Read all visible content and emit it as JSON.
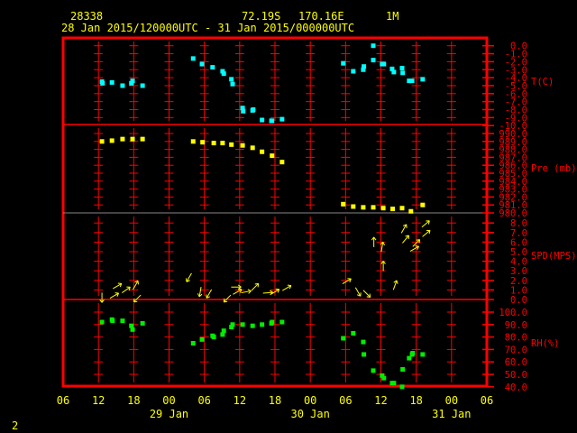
{
  "header": {
    "station": "28338",
    "lat": "72.19S",
    "lon": "170.16E",
    "height": "1M",
    "period": "28 Jan 2015/120000UTC - 31 Jan 2015/000000UTC"
  },
  "page_number": "2",
  "colors": {
    "frame": "#ff0000",
    "temp": "#00ffff",
    "pressure": "#ffff00",
    "wind": "#ffff00",
    "rh": "#00ee00",
    "text": "#ffff00"
  },
  "chart_data": {
    "type": "scatter",
    "x_units": "hours since 28 Jan 2015 06UTC",
    "x_range": [
      0,
      72
    ],
    "x_ticks": [
      "06",
      "12",
      "18",
      "00",
      "06",
      "12",
      "18",
      "00",
      "06",
      "12",
      "18",
      "00",
      "06"
    ],
    "x_dates": [
      {
        "label": "29 Jan",
        "hour": 18
      },
      {
        "label": "30 Jan",
        "hour": 42
      },
      {
        "label": "31 Jan",
        "hour": 66
      }
    ],
    "panels": [
      {
        "name": "temperature",
        "label": "T(C)",
        "ticks": [
          "0.0",
          "-1.0",
          "-2.0",
          "-3.0",
          "-4.0",
          "-5.0",
          "-6.0",
          "-7.0",
          "-8.0",
          "-9.0",
          "-10.0"
        ],
        "range": [
          -10,
          0
        ],
        "points": [
          [
            6.6,
            -4.5
          ],
          [
            6.7,
            -4.7
          ],
          [
            8.3,
            -4.6
          ],
          [
            10.1,
            -5.0
          ],
          [
            11.6,
            -4.7
          ],
          [
            11.8,
            -4.4
          ],
          [
            13.5,
            -5.0
          ],
          [
            22.1,
            -1.6
          ],
          [
            23.6,
            -2.3
          ],
          [
            25.4,
            -2.7
          ],
          [
            27.1,
            -3.2
          ],
          [
            27.3,
            -3.5
          ],
          [
            28.6,
            -4.2
          ],
          [
            28.8,
            -4.8
          ],
          [
            30.5,
            -7.8
          ],
          [
            30.6,
            -8.2
          ],
          [
            32.2,
            -8.1
          ],
          [
            32.3,
            -8.0
          ],
          [
            33.8,
            -9.3
          ],
          [
            35.4,
            -9.4
          ],
          [
            35.5,
            -9.4
          ],
          [
            37.2,
            -9.2
          ],
          [
            47.6,
            -2.2
          ],
          [
            49.3,
            -3.2
          ],
          [
            51.0,
            -3.0
          ],
          [
            51.1,
            -2.6
          ],
          [
            52.7,
            0.0
          ],
          [
            52.7,
            -1.8
          ],
          [
            54.2,
            -2.3
          ],
          [
            54.5,
            -2.3
          ],
          [
            55.9,
            -2.9
          ],
          [
            56.2,
            -3.3
          ],
          [
            57.6,
            -2.8
          ],
          [
            57.7,
            -3.4
          ],
          [
            58.8,
            -4.4
          ],
          [
            59.3,
            -4.4
          ],
          [
            61.1,
            -4.2
          ]
        ]
      },
      {
        "name": "pressure",
        "label": "Pre (mb)",
        "ticks": [
          "990.0",
          "989.0",
          "988.0",
          "987.0",
          "986.0",
          "985.0",
          "984.0",
          "983.0",
          "982.0",
          "981.0",
          "980.0"
        ],
        "range": [
          980,
          990
        ],
        "points": [
          [
            6.6,
            989.0
          ],
          [
            8.3,
            989.1
          ],
          [
            10.1,
            989.3
          ],
          [
            11.8,
            989.3
          ],
          [
            13.5,
            989.3
          ],
          [
            22.1,
            989.0
          ],
          [
            23.7,
            988.9
          ],
          [
            25.6,
            988.8
          ],
          [
            27.1,
            988.8
          ],
          [
            28.6,
            988.6
          ],
          [
            30.5,
            988.5
          ],
          [
            32.2,
            988.2
          ],
          [
            33.8,
            987.7
          ],
          [
            35.5,
            987.2
          ],
          [
            37.2,
            986.4
          ],
          [
            47.6,
            981.1
          ],
          [
            49.3,
            980.8
          ],
          [
            51.0,
            980.7
          ],
          [
            52.7,
            980.7
          ],
          [
            54.4,
            980.6
          ],
          [
            56.0,
            980.5
          ],
          [
            57.6,
            980.6
          ],
          [
            59.1,
            980.2
          ],
          [
            61.1,
            981.0
          ]
        ]
      },
      {
        "name": "wind",
        "label": "SPD(MPS)",
        "ticks": [
          "8.0",
          "7.0",
          "6.0",
          "5.0",
          "4.0",
          "3.0",
          "2.0",
          "1.0",
          "0.0"
        ],
        "range": [
          0,
          8
        ],
        "points": [
          [
            6.6,
            0.2,
            180
          ],
          [
            8.7,
            0.4,
            60
          ],
          [
            9.2,
            1.4,
            60
          ],
          [
            10.7,
            1.0,
            55
          ],
          [
            12.3,
            1.5,
            30
          ],
          [
            12.6,
            0.1,
            225
          ],
          [
            21.4,
            2.3,
            210
          ],
          [
            23.3,
            0.8,
            190
          ],
          [
            24.8,
            0.6,
            210
          ],
          [
            27.9,
            0.1,
            225
          ],
          [
            29.4,
            1.3,
            90
          ],
          [
            29.6,
            0.8,
            60
          ],
          [
            31.1,
            0.8,
            80
          ],
          [
            32.6,
            1.3,
            45
          ],
          [
            34.8,
            0.7,
            85
          ],
          [
            36.0,
            0.8,
            60
          ],
          [
            38.0,
            1.2,
            60
          ],
          [
            48.2,
            1.9,
            60
          ],
          [
            50.1,
            0.8,
            150
          ],
          [
            51.6,
            0.6,
            135
          ],
          [
            52.8,
            6.0,
            0
          ],
          [
            54.2,
            5.5,
            10
          ],
          [
            54.4,
            3.5,
            0
          ],
          [
            56.4,
            1.5,
            20
          ],
          [
            57.9,
            7.4,
            30
          ],
          [
            58.2,
            6.3,
            40
          ],
          [
            60.0,
            5.9,
            45
          ],
          [
            59.7,
            5.3,
            60
          ],
          [
            61.6,
            7.9,
            50
          ],
          [
            61.7,
            6.9,
            50
          ]
        ]
      },
      {
        "name": "humidity",
        "label": "RH(%)",
        "ticks": [
          "100.0",
          "90.0",
          "80.0",
          "70.0",
          "60.0",
          "50.0",
          "40.0"
        ],
        "range": [
          40,
          100
        ],
        "points": [
          [
            6.6,
            92
          ],
          [
            8.3,
            94
          ],
          [
            8.4,
            93
          ],
          [
            10.1,
            93
          ],
          [
            11.6,
            89
          ],
          [
            11.8,
            86
          ],
          [
            13.5,
            91
          ],
          [
            22.1,
            75
          ],
          [
            23.6,
            78
          ],
          [
            25.4,
            81
          ],
          [
            25.6,
            80
          ],
          [
            27.1,
            82
          ],
          [
            27.3,
            85
          ],
          [
            28.6,
            88
          ],
          [
            28.8,
            90
          ],
          [
            30.5,
            90
          ],
          [
            32.2,
            89
          ],
          [
            33.8,
            90
          ],
          [
            35.4,
            91
          ],
          [
            35.5,
            92
          ],
          [
            37.2,
            92
          ],
          [
            47.6,
            79
          ],
          [
            49.3,
            83
          ],
          [
            51.0,
            76
          ],
          [
            51.1,
            66
          ],
          [
            52.7,
            53
          ],
          [
            54.2,
            49
          ],
          [
            54.5,
            47
          ],
          [
            55.9,
            43
          ],
          [
            56.2,
            43
          ],
          [
            57.6,
            40
          ],
          [
            57.7,
            54
          ],
          [
            58.8,
            63
          ],
          [
            59.3,
            66
          ],
          [
            59.4,
            67
          ],
          [
            61.1,
            66
          ]
        ]
      }
    ]
  }
}
